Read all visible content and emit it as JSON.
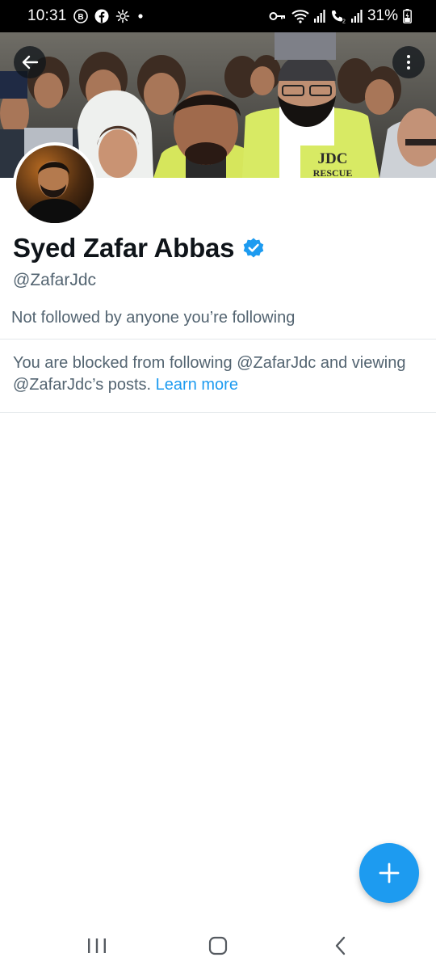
{
  "status_bar": {
    "time": "10:31",
    "battery_percent": "31%",
    "left_icons": [
      "b-badge-icon",
      "facebook-icon",
      "settings-gear-icon",
      "dot-icon"
    ],
    "right_icons": [
      "key-icon",
      "wifi-icon",
      "signal-icon",
      "call-signal-icon",
      "signal-icon-2",
      "battery-icon"
    ]
  },
  "header": {
    "back_icon": "back-arrow-icon",
    "more_icon": "more-vertical-icon"
  },
  "banner": {
    "vest_text_1": "JDC",
    "vest_text_2": "RESCUE"
  },
  "profile": {
    "display_name": "Syed Zafar Abbas",
    "verified_icon": "verified-badge-icon",
    "handle": "@ZafarJdc",
    "followers_note": "Not followed by anyone you’re following"
  },
  "blocked": {
    "message": "You are blocked from following @ZafarJdc and viewing @ZafarJdc’s posts.",
    "link_label": "Learn more"
  },
  "fab": {
    "icon": "plus-icon"
  },
  "nav_bar": {
    "items": [
      "recents-icon",
      "home-icon",
      "back-icon"
    ]
  },
  "colors": {
    "accent": "#1d9bf0",
    "text_primary": "#0f1419",
    "text_secondary": "#536471",
    "divider": "#e3e7ea"
  }
}
